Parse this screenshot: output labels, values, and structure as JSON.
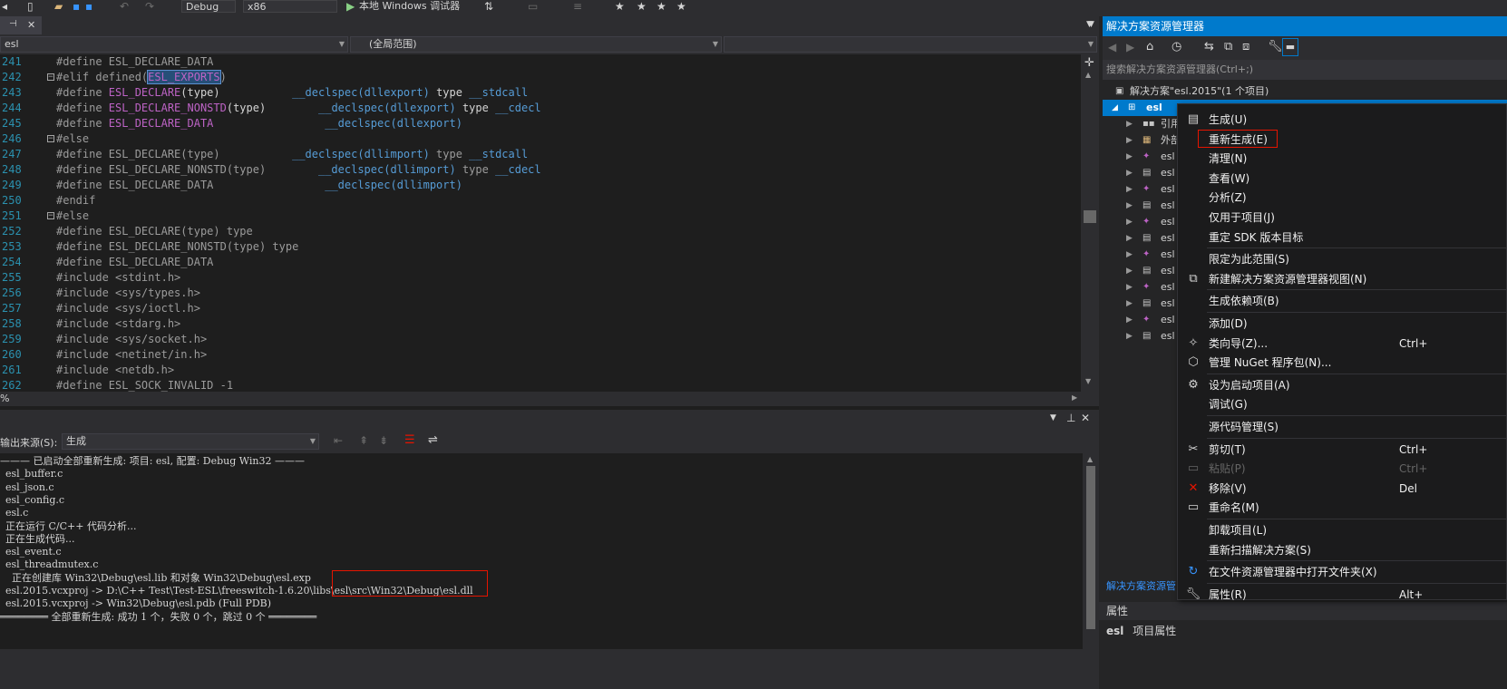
{
  "toolbar": {
    "config_value": "Debug",
    "platform_value": "x86",
    "run_label": "本地 Windows 调试器",
    "star_icons": [
      "star-icon",
      "star-icon",
      "star-icon",
      "star-icon"
    ]
  },
  "editor": {
    "tab_pin_glyph": "⊣",
    "tab_close_glyph": "✕",
    "nav": {
      "project": "esl",
      "scope": "(全局范围)",
      "member": ""
    },
    "lines": [
      {
        "n": "241",
        "fold": "",
        "parts": [
          [
            "#define ",
            "pp"
          ],
          [
            "ESL_DECLARE_DATA",
            "dim"
          ]
        ]
      },
      {
        "n": "242",
        "fold": "−",
        "parts": [
          [
            "#elif defined(",
            "dim"
          ],
          [
            "ESL_EXPORTS",
            "hl"
          ],
          [
            ")",
            "dim"
          ]
        ]
      },
      {
        "n": "243",
        "fold": "",
        "parts": [
          [
            "#define ",
            "pp"
          ],
          [
            "ESL_DECLARE",
            "macro"
          ],
          [
            "(type)           ",
            "id"
          ],
          [
            "__declspec(dllexport) ",
            "kw"
          ],
          [
            "type ",
            "id"
          ],
          [
            "__stdcall",
            "kw"
          ]
        ]
      },
      {
        "n": "244",
        "fold": "",
        "parts": [
          [
            "#define ",
            "pp"
          ],
          [
            "ESL_DECLARE_NONSTD",
            "macro"
          ],
          [
            "(type)        ",
            "id"
          ],
          [
            "__declspec(dllexport) ",
            "kw"
          ],
          [
            "type ",
            "id"
          ],
          [
            "__cdecl",
            "kw"
          ]
        ]
      },
      {
        "n": "245",
        "fold": "",
        "parts": [
          [
            "#define ",
            "pp"
          ],
          [
            "ESL_DECLARE_DATA",
            "macro"
          ],
          [
            "                 ",
            "id"
          ],
          [
            "__declspec(dllexport)",
            "kw"
          ]
        ]
      },
      {
        "n": "246",
        "fold": "−",
        "parts": [
          [
            "#else",
            "dim"
          ]
        ]
      },
      {
        "n": "247",
        "fold": "",
        "parts": [
          [
            "#define ESL_DECLARE(type)           ",
            "dim"
          ],
          [
            "__declspec(dllimport) ",
            "kw"
          ],
          [
            "type ",
            "dim"
          ],
          [
            "__stdcall",
            "kw"
          ]
        ]
      },
      {
        "n": "248",
        "fold": "",
        "parts": [
          [
            "#define ESL_DECLARE_NONSTD(type)        ",
            "dim"
          ],
          [
            "__declspec(dllimport) ",
            "kw"
          ],
          [
            "type ",
            "dim"
          ],
          [
            "__cdecl",
            "kw"
          ]
        ]
      },
      {
        "n": "249",
        "fold": "",
        "parts": [
          [
            "#define ESL_DECLARE_DATA                 ",
            "dim"
          ],
          [
            "__declspec(dllimport)",
            "kw"
          ]
        ]
      },
      {
        "n": "250",
        "fold": "",
        "parts": [
          [
            "#endif",
            "dim"
          ]
        ]
      },
      {
        "n": "251",
        "fold": "−",
        "parts": [
          [
            "#else",
            "dim"
          ]
        ]
      },
      {
        "n": "252",
        "fold": "",
        "parts": [
          [
            "#define ESL_DECLARE(type) type",
            "dim"
          ]
        ]
      },
      {
        "n": "253",
        "fold": "",
        "parts": [
          [
            "#define ESL_DECLARE_NONSTD(type) type",
            "dim"
          ]
        ]
      },
      {
        "n": "254",
        "fold": "",
        "parts": [
          [
            "#define ESL_DECLARE_DATA",
            "dim"
          ]
        ]
      },
      {
        "n": "255",
        "fold": "",
        "parts": [
          [
            "#include ",
            "dim"
          ],
          [
            "<stdint.h>",
            "inc"
          ]
        ]
      },
      {
        "n": "256",
        "fold": "",
        "parts": [
          [
            "#include ",
            "dim"
          ],
          [
            "<sys/types.h>",
            "inc"
          ]
        ]
      },
      {
        "n": "257",
        "fold": "",
        "parts": [
          [
            "#include ",
            "dim"
          ],
          [
            "<sys/ioctl.h>",
            "inc"
          ]
        ]
      },
      {
        "n": "258",
        "fold": "",
        "parts": [
          [
            "#include ",
            "dim"
          ],
          [
            "<stdarg.h>",
            "inc"
          ]
        ]
      },
      {
        "n": "259",
        "fold": "",
        "parts": [
          [
            "#include ",
            "dim"
          ],
          [
            "<sys/socket.h>",
            "inc"
          ]
        ]
      },
      {
        "n": "260",
        "fold": "",
        "parts": [
          [
            "#include ",
            "dim"
          ],
          [
            "<netinet/in.h>",
            "inc"
          ]
        ]
      },
      {
        "n": "261",
        "fold": "",
        "parts": [
          [
            "#include ",
            "dim"
          ],
          [
            "<netdb.h>",
            "inc"
          ]
        ]
      },
      {
        "n": "262",
        "fold": "",
        "parts": [
          [
            "#define ESL_SOCK_INVALID -1",
            "dim"
          ]
        ]
      }
    ],
    "zoom": "%"
  },
  "output": {
    "source_label": "输出来源(S):",
    "source_value": "生成",
    "lines": [
      "——— 已启动全部重新生成: 项目: esl, 配置: Debug Win32 ———",
      "esl_buffer.c",
      "esl_json.c",
      "esl_config.c",
      "esl.c",
      "正在运行 C/C++ 代码分析...",
      "正在生成代码...",
      "esl_event.c",
      "esl_threadmutex.c",
      "  正在创建库 Win32\\Debug\\esl.lib 和对象 Win32\\Debug\\esl.exp",
      "esl.2015.vcxproj -> D:\\C++ Test\\Test-ESL\\freeswitch-1.6.20\\libs\\esl\\src\\Win32\\Debug\\esl.dll",
      "esl.2015.vcxproj -> Win32\\Debug\\esl.pdb (Full PDB)",
      "════════ 全部重新生成: 成功 1 个，失败 0 个，跳过 0 个 ════════"
    ]
  },
  "solution_explorer": {
    "title": "解决方案资源管理器",
    "search_placeholder": "搜索解决方案资源管理器(Ctrl+;)",
    "solution_label": "解决方案\"esl.2015\"(1 个项目)",
    "project_label": "esl",
    "items": [
      {
        "label": "引用",
        "icon": "references-icon"
      },
      {
        "label": "外部",
        "icon": "external-deps-icon"
      },
      {
        "label": "esl",
        "icon": "source-file-icon"
      },
      {
        "label": "esl",
        "icon": "header-file-icon"
      },
      {
        "label": "esl",
        "icon": "source-file-icon"
      },
      {
        "label": "esl",
        "icon": "header-file-icon"
      },
      {
        "label": "esl",
        "icon": "source-file-icon"
      },
      {
        "label": "esl",
        "icon": "header-file-icon"
      },
      {
        "label": "esl",
        "icon": "source-file-icon"
      },
      {
        "label": "esl",
        "icon": "header-file-icon"
      },
      {
        "label": "esl",
        "icon": "source-file-icon"
      },
      {
        "label": "esl",
        "icon": "header-file-icon"
      },
      {
        "label": "esl",
        "icon": "source-file-icon"
      },
      {
        "label": "esl",
        "icon": "header-file-icon"
      }
    ],
    "footer_tab": "解决方案资源管"
  },
  "properties": {
    "title": "属性",
    "subject": "esl",
    "subject_desc": "项目属性"
  },
  "context_menu": {
    "items": [
      {
        "label": "生成(U)",
        "shortcut": "",
        "icon": "build-icon",
        "sep_before": false
      },
      {
        "label": "重新生成(E)",
        "shortcut": "",
        "icon": "",
        "sep_before": false,
        "boxed": true
      },
      {
        "label": "清理(N)",
        "shortcut": "",
        "icon": "",
        "sep_before": false
      },
      {
        "label": "查看(W)",
        "shortcut": "",
        "icon": "",
        "sep_before": false
      },
      {
        "label": "分析(Z)",
        "shortcut": "",
        "icon": "",
        "sep_before": false
      },
      {
        "label": "仅用于项目(J)",
        "shortcut": "",
        "icon": "",
        "sep_before": false
      },
      {
        "label": "重定 SDK 版本目标",
        "shortcut": "",
        "icon": "",
        "sep_before": false
      },
      {
        "label": "限定为此范围(S)",
        "shortcut": "",
        "icon": "",
        "sep_before": true
      },
      {
        "label": "新建解决方案资源管理器视图(N)",
        "shortcut": "",
        "icon": "new-view-icon",
        "sep_before": false
      },
      {
        "label": "生成依赖项(B)",
        "shortcut": "",
        "icon": "",
        "sep_before": true
      },
      {
        "label": "添加(D)",
        "shortcut": "",
        "icon": "",
        "sep_before": true
      },
      {
        "label": "类向导(Z)...",
        "shortcut": "Ctrl+",
        "icon": "class-wizard-icon",
        "sep_before": false
      },
      {
        "label": "管理 NuGet 程序包(N)...",
        "shortcut": "",
        "icon": "nuget-icon",
        "sep_before": false
      },
      {
        "label": "设为启动项目(A)",
        "shortcut": "",
        "icon": "gear-icon",
        "sep_before": true
      },
      {
        "label": "调试(G)",
        "shortcut": "",
        "icon": "",
        "sep_before": false
      },
      {
        "label": "源代码管理(S)",
        "shortcut": "",
        "icon": "",
        "sep_before": true
      },
      {
        "label": "剪切(T)",
        "shortcut": "Ctrl+",
        "icon": "scissors-icon",
        "sep_before": true
      },
      {
        "label": "粘贴(P)",
        "shortcut": "Ctrl+",
        "icon": "paste-icon",
        "sep_before": false,
        "disabled": true
      },
      {
        "label": "移除(V)",
        "shortcut": "Del",
        "icon": "remove-icon",
        "sep_before": false
      },
      {
        "label": "重命名(M)",
        "shortcut": "",
        "icon": "rename-icon",
        "sep_before": false
      },
      {
        "label": "卸载项目(L)",
        "shortcut": "",
        "icon": "",
        "sep_before": true
      },
      {
        "label": "重新扫描解决方案(S)",
        "shortcut": "",
        "icon": "",
        "sep_before": false
      },
      {
        "label": "在文件资源管理器中打开文件夹(X)",
        "shortcut": "",
        "icon": "open-folder-icon",
        "sep_before": true
      },
      {
        "label": "属性(R)",
        "shortcut": "Alt+",
        "icon": "wrench-icon",
        "sep_before": true
      }
    ]
  },
  "colors": {
    "accent": "#007acc",
    "highlight_box": "#e51400",
    "background": "#1e1e1e"
  }
}
